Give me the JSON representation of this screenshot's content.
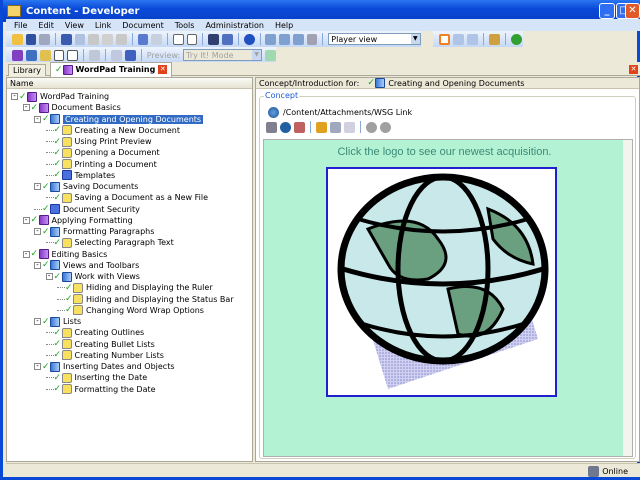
{
  "window": {
    "title": "Content - Developer"
  },
  "menu": [
    "File",
    "Edit",
    "View",
    "Link",
    "Document",
    "Tools",
    "Administration",
    "Help"
  ],
  "toolbar": {
    "view_select": "Player view",
    "preview_label": "Preview:",
    "preview_mode": "Try It! Mode"
  },
  "tabs": [
    {
      "label": "Library"
    },
    {
      "label": "WordPad Training"
    }
  ],
  "tree": {
    "header": "Name",
    "items": [
      {
        "level": 0,
        "type": "book",
        "label": "WordPad Training",
        "exp": true
      },
      {
        "level": 1,
        "type": "book",
        "label": "Document Basics",
        "exp": true
      },
      {
        "level": 2,
        "type": "sec",
        "label": "Creating and Opening Documents",
        "exp": true,
        "selected": true
      },
      {
        "level": 3,
        "type": "topic",
        "label": "Creating a New Document"
      },
      {
        "level": 3,
        "type": "topic",
        "label": "Using Print Preview"
      },
      {
        "level": 3,
        "type": "topic",
        "label": "Opening a Document"
      },
      {
        "level": 3,
        "type": "topic",
        "label": "Printing a Document"
      },
      {
        "level": 3,
        "type": "doc",
        "label": "Templates"
      },
      {
        "level": 2,
        "type": "sec",
        "label": "Saving Documents",
        "exp": true
      },
      {
        "level": 3,
        "type": "topic",
        "label": "Saving a Document as a New File"
      },
      {
        "level": 2,
        "type": "doc",
        "label": "Document Security"
      },
      {
        "level": 1,
        "type": "book",
        "label": "Applying Formatting",
        "exp": true
      },
      {
        "level": 2,
        "type": "sec",
        "label": "Formatting Paragraphs",
        "exp": true
      },
      {
        "level": 3,
        "type": "topic",
        "label": "Selecting Paragraph Text"
      },
      {
        "level": 1,
        "type": "book",
        "label": "Editing Basics",
        "exp": true
      },
      {
        "level": 2,
        "type": "sec",
        "label": "Views and Toolbars",
        "exp": true
      },
      {
        "level": 3,
        "type": "sec",
        "label": "Work with Views",
        "exp": true
      },
      {
        "level": 4,
        "type": "topic",
        "label": "Hiding and Displaying the Ruler"
      },
      {
        "level": 4,
        "type": "topic",
        "label": "Hiding and Displaying the Status Bar"
      },
      {
        "level": 4,
        "type": "topic",
        "label": "Changing Word Wrap Options"
      },
      {
        "level": 2,
        "type": "sec",
        "label": "Lists",
        "exp": true
      },
      {
        "level": 3,
        "type": "topic",
        "label": "Creating Outlines"
      },
      {
        "level": 3,
        "type": "topic",
        "label": "Creating Bullet Lists"
      },
      {
        "level": 3,
        "type": "topic",
        "label": "Creating Number Lists"
      },
      {
        "level": 2,
        "type": "sec",
        "label": "Inserting Dates and Objects",
        "exp": true
      },
      {
        "level": 3,
        "type": "topic",
        "label": "Inserting the Date"
      },
      {
        "level": 3,
        "type": "topic",
        "label": "Formatting the Date"
      }
    ]
  },
  "concept": {
    "header_label": "Concept/Introduction for:",
    "header_item": "Creating and Opening Documents",
    "group_label": "Concept",
    "path": "/Content/Attachments/WSG Link",
    "message": "Click the logo to see our newest acquisition."
  },
  "status": {
    "text": "Online"
  }
}
